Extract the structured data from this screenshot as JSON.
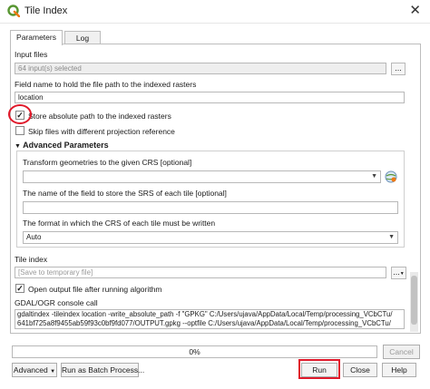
{
  "window": {
    "title": "Tile Index",
    "close_glyph": "✕"
  },
  "tabs": [
    {
      "label": "Parameters",
      "active": true
    },
    {
      "label": "Log",
      "active": false
    }
  ],
  "params": {
    "input_files": {
      "label": "Input files",
      "value": "64 input(s) selected",
      "browse": "..."
    },
    "field_name": {
      "label": "Field name to hold the file path to the indexed rasters",
      "value": "location"
    },
    "store_absolute": {
      "label": "Store absolute path to the indexed rasters",
      "checked": true,
      "mark": "✓"
    },
    "skip_files": {
      "label": "Skip files with different projection reference",
      "checked": false
    },
    "advanced": {
      "header": "Advanced Parameters",
      "toggle": "▼",
      "transform": {
        "label": "Transform geometries to the given CRS [optional]",
        "value": ""
      },
      "srs_field": {
        "label": "The name of the field to store the SRS of each tile [optional]",
        "value": ""
      },
      "crs_format": {
        "label": "The format in which the CRS of each tile must be written",
        "value": "Auto"
      }
    },
    "tile_index": {
      "label": "Tile index",
      "placeholder": "[Save to temporary file]",
      "browse": "..."
    },
    "open_output": {
      "label": "Open output file after running algorithm",
      "checked": true,
      "mark": "✓"
    },
    "console": {
      "label": "GDAL/OGR console call",
      "line1": "gdaltindex -tileindex location -write_absolute_path -f \"GPKG\" C:/Users/ujava/AppData/Local/Temp/processing_VCbCTu/",
      "line2": "641bf725a8f9455ab59f93c0bf9fd077/OUTPUT.gpkg --optfile C:/Users/ujava/AppData/Local/Temp/processing_VCbCTu/"
    }
  },
  "progress": {
    "percent": 0,
    "label": "0%"
  },
  "buttons": {
    "cancel": "Cancel",
    "advanced": "Advanced",
    "batch": "Run as Batch Process...",
    "run": "Run",
    "close": "Close",
    "help": "Help"
  },
  "icons": {
    "app": "qgis-logo-icon",
    "crs": "crs-selector-icon",
    "dropdown": "chevron-down-icon"
  },
  "colors": {
    "highlight": "#e0192a",
    "qgis_green": "#589632",
    "qgis_yellow": "#ee7913"
  }
}
